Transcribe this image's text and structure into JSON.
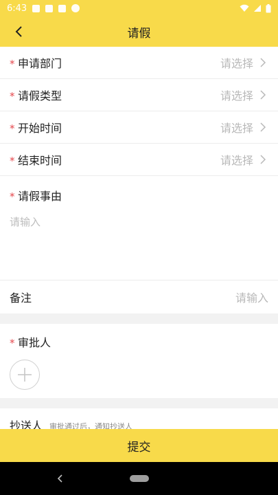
{
  "status_bar": {
    "time": "6:43"
  },
  "header": {
    "title": "请假",
    "back_icon": "chevron-left-icon"
  },
  "form": {
    "required_mark": "*",
    "rows": [
      {
        "label": "申请部门",
        "value": "请选择"
      },
      {
        "label": "请假类型",
        "value": "请选择"
      },
      {
        "label": "开始时间",
        "value": "请选择"
      },
      {
        "label": "结束时间",
        "value": "请选择"
      }
    ],
    "reason": {
      "label": "请假事由",
      "placeholder": "请输入"
    },
    "note": {
      "label": "备注",
      "placeholder": "请输入"
    },
    "approver": {
      "label": "审批人",
      "add_icon": "plus-icon"
    },
    "cc": {
      "label": "抄送人",
      "hint": "审批通过后，通知抄送人"
    }
  },
  "footer": {
    "submit_label": "提交"
  },
  "colors": {
    "accent": "#f8da4a",
    "required": "#e5484d",
    "placeholder": "#b8b8b8"
  }
}
